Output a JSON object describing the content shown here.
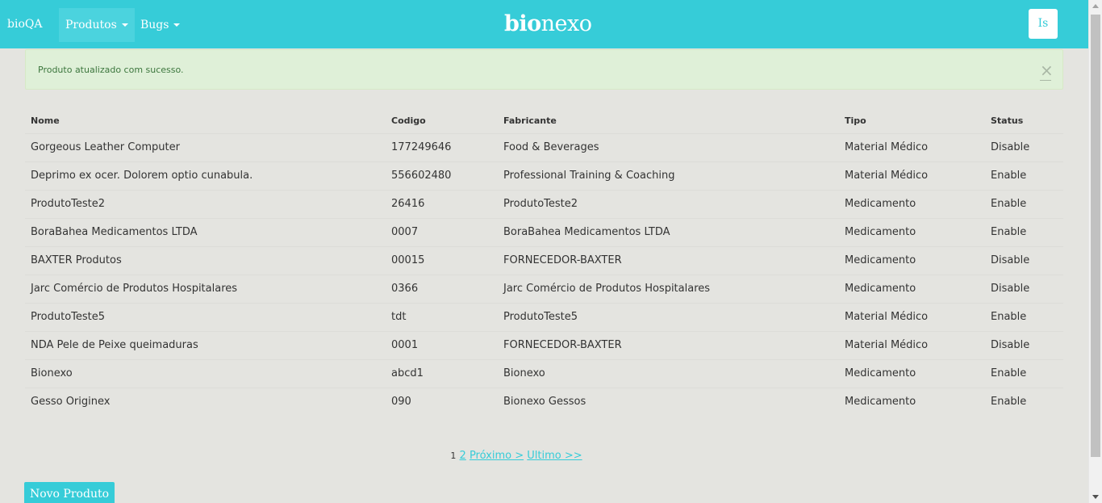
{
  "navbar": {
    "brand": "bioQA",
    "menu": [
      {
        "label": "Produtos"
      },
      {
        "label": "Bugs"
      }
    ],
    "logo": {
      "part1": "bio",
      "part2": "nexo"
    },
    "avatar_initials": "Is"
  },
  "alert": {
    "message": "Produto atualizado com sucesso.",
    "close_symbol": "×"
  },
  "table": {
    "headers": [
      "Nome",
      "Codigo",
      "Fabricante",
      "Tipo",
      "Status"
    ],
    "rows": [
      [
        "Gorgeous Leather Computer",
        "177249646",
        "Food & Beverages",
        "Material Médico",
        "Disable"
      ],
      [
        "Deprimo ex ocer. Dolorem optio cunabula.",
        "556602480",
        "Professional Training & Coaching",
        "Material Médico",
        "Enable"
      ],
      [
        "ProdutoTeste2",
        "26416",
        "ProdutoTeste2",
        "Medicamento",
        "Enable"
      ],
      [
        "BoraBahea Medicamentos LTDA",
        "0007",
        "BoraBahea Medicamentos LTDA",
        "Medicamento",
        "Enable"
      ],
      [
        "BAXTER Produtos",
        "00015",
        "FORNECEDOR-BAXTER",
        "Medicamento",
        "Disable"
      ],
      [
        "Jarc Comércio de Produtos Hospitalares",
        "0366",
        "Jarc Comércio de Produtos Hospitalares",
        "Medicamento",
        "Disable"
      ],
      [
        "ProdutoTeste5",
        "tdt",
        "ProdutoTeste5",
        "Material Médico",
        "Enable"
      ],
      [
        "NDA Pele de Peixe queimaduras",
        "0001",
        "FORNECEDOR-BAXTER",
        "Material Médico",
        "Disable"
      ],
      [
        "Bionexo",
        "abcd1",
        "Bionexo",
        "Medicamento",
        "Enable"
      ],
      [
        "Gesso Originex",
        "090",
        "Bionexo Gessos",
        "Medicamento",
        "Enable"
      ]
    ]
  },
  "pagination": {
    "current": "1",
    "page2": "2",
    "next": "Próximo >",
    "last": "Ultimo >>"
  },
  "actions": {
    "new_product": "Novo Produto"
  },
  "colors": {
    "accent": "#36ccd8",
    "alert_bg": "#dff0d8",
    "alert_text": "#3c763d",
    "page_bg": "#e4e4e0"
  }
}
